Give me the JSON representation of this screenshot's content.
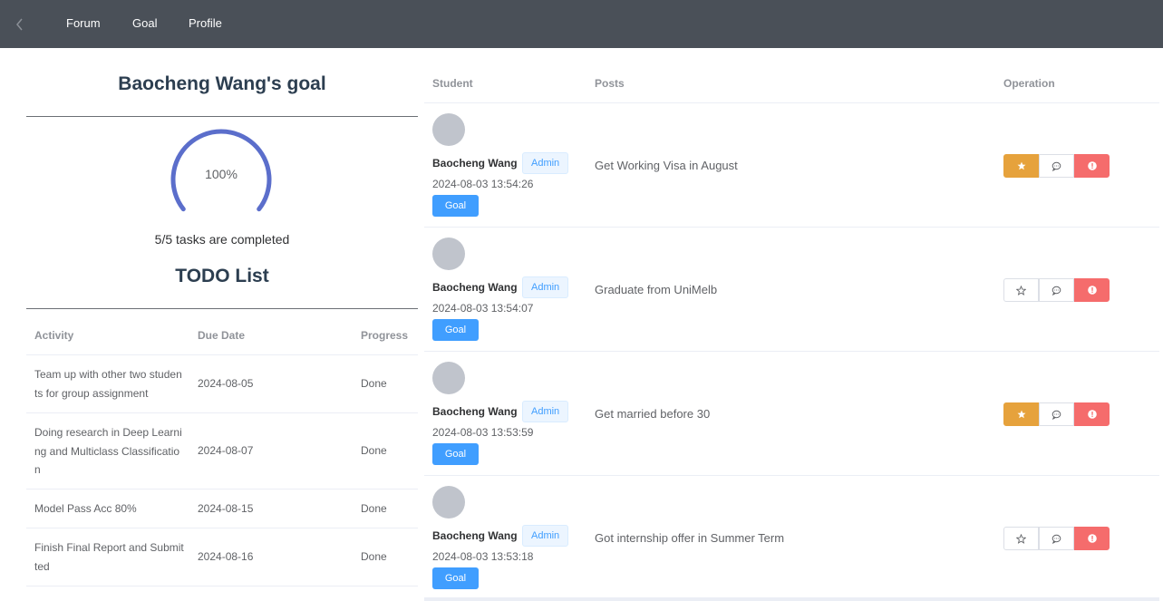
{
  "nav": {
    "back_icon": "chevron-left-icon",
    "items": [
      {
        "label": "Forum"
      },
      {
        "label": "Goal"
      },
      {
        "label": "Profile"
      }
    ]
  },
  "goal_panel": {
    "title": "Baocheng Wang's goal",
    "progress_percent": 100,
    "progress_label": "100%",
    "tasks_summary": "5/5 tasks are completed",
    "todo_title": "TODO List",
    "gauge_color": "#5b6ecb",
    "todo_table": {
      "headers": {
        "activity": "Activity",
        "due_date": "Due Date",
        "progress": "Progress"
      },
      "rows": [
        {
          "activity": "Team up with other two students for group assignment",
          "due_date": "2024-08-05",
          "progress": "Done"
        },
        {
          "activity": "Doing research in Deep Learning and Multiclass Classification",
          "due_date": "2024-08-07",
          "progress": "Done"
        },
        {
          "activity": "Model Pass Acc 80%",
          "due_date": "2024-08-15",
          "progress": "Done"
        },
        {
          "activity": "Finish Final Report and Submitted",
          "due_date": "2024-08-16",
          "progress": "Done"
        }
      ]
    }
  },
  "posts_table": {
    "headers": {
      "student": "Student",
      "posts": "Posts",
      "operation": "Operation"
    },
    "colors": {
      "primary": "#409eff",
      "warning": "#e6a23c",
      "danger": "#f56c6c"
    },
    "rows": [
      {
        "author": "Baocheng Wang",
        "role": "Admin",
        "timestamp": "2024-08-03 13:54:26",
        "goal_button": "Goal",
        "post": "Get Working Visa in August",
        "starred": true
      },
      {
        "author": "Baocheng Wang",
        "role": "Admin",
        "timestamp": "2024-08-03 13:54:07",
        "goal_button": "Goal",
        "post": "Graduate from UniMelb",
        "starred": false
      },
      {
        "author": "Baocheng Wang",
        "role": "Admin",
        "timestamp": "2024-08-03 13:53:59",
        "goal_button": "Goal",
        "post": "Get married before 30",
        "starred": true
      },
      {
        "author": "Baocheng Wang",
        "role": "Admin",
        "timestamp": "2024-08-03 13:53:18",
        "goal_button": "Goal",
        "post": "Got internship offer in Summer Term",
        "starred": false
      }
    ]
  }
}
